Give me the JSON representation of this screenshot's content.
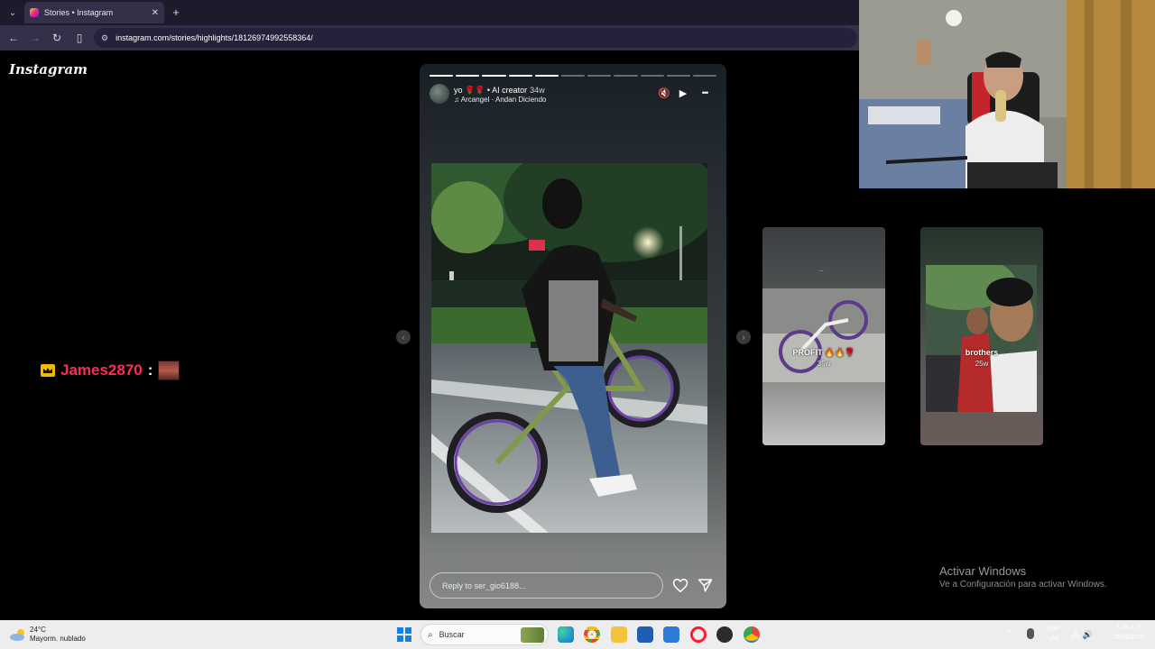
{
  "browser": {
    "tab_title": "Stories • Instagram",
    "tab_close": "✕",
    "new_tab": "+",
    "tab_dropdown": "⌄",
    "nav": {
      "back": "←",
      "forward": "→",
      "reload": "↻",
      "split": "▯"
    },
    "url": "instagram.com/stories/highlights/18126974992558364/"
  },
  "instagram": {
    "logo": "Instagram"
  },
  "story": {
    "progress_total": 11,
    "progress_done": 5,
    "username": "yo 🌹🌹 • AI creator",
    "age": "34w",
    "music": "♫ Arcangel · Andan Diciendo",
    "mute_icon": "🔇",
    "play_icon": "▶",
    "more_icon": "•••",
    "image_alt": "person with green bicycle in park at night",
    "reply_placeholder": "Reply to ser_gio6188...",
    "prev_arrow": "‹",
    "next_arrow": "›"
  },
  "previews": [
    {
      "name": "PROFIT 🔥🔥🌹",
      "age": "35w",
      "ring": "..."
    },
    {
      "name": "brothers",
      "age": "25w"
    }
  ],
  "chat": {
    "user": "James2870",
    "colon": ":"
  },
  "windows_activation": {
    "title": "Activar Windows",
    "subtitle": "Ve a Configuración para activar Windows."
  },
  "taskbar": {
    "weather_temp": "24°C",
    "weather_desc": "Mayorm. nublado",
    "search_placeholder": "Buscar",
    "tray_chevron": "^",
    "lang_1": "ESP",
    "lang_2": "LAA",
    "tray_icons": "🖧 🔊",
    "time": "7:39 p. m.",
    "date": "25/08/2026"
  },
  "colors": {
    "accent_pink": "#ff2b55",
    "windows_blue": "#1a7fe0"
  }
}
